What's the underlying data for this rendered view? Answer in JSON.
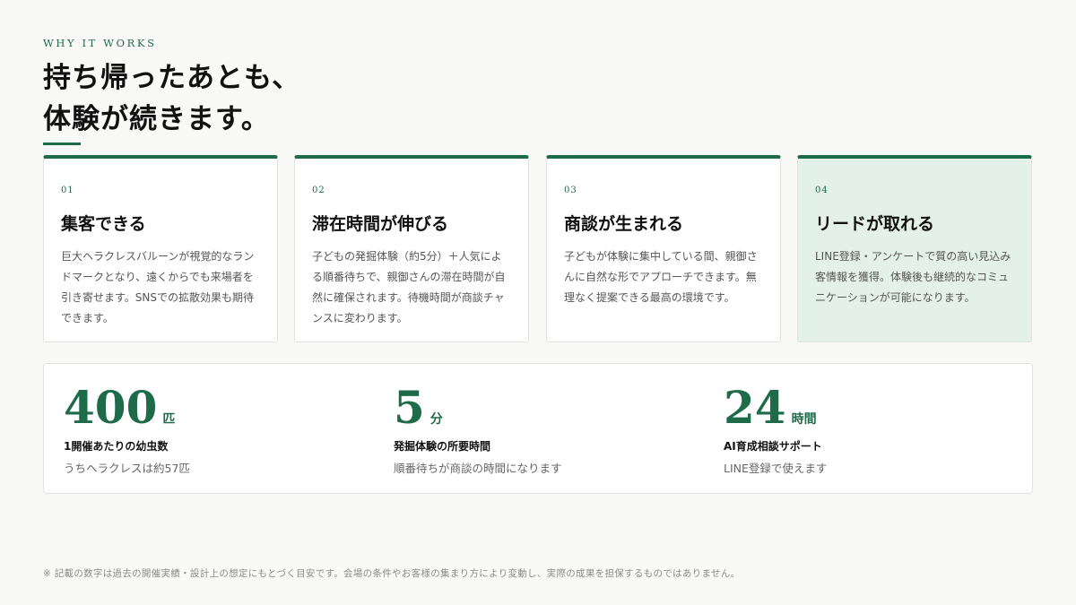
{
  "header": {
    "eyebrow": "WHY IT WORKS",
    "title_line1": "持ち帰ったあとも、",
    "title_line2": "体験が続きます。"
  },
  "cards": [
    {
      "num": "01",
      "title": "集客できる",
      "desc": "巨大ヘラクレスバルーンが視覚的なランドマークとなり、遠くからでも来場者を引き寄せます。SNSでの拡散効果も期待できます。"
    },
    {
      "num": "02",
      "title": "滞在時間が伸びる",
      "desc": "子どもの発掘体験（約5分）＋人気による順番待ちで、親御さんの滞在時間が自然に確保されます。待機時間が商談チャンスに変わります。"
    },
    {
      "num": "03",
      "title": "商談が生まれる",
      "desc": "子どもが体験に集中している間、親御さんに自然な形でアプローチできます。無理なく提案できる最高の環境です。"
    },
    {
      "num": "04",
      "title": "リードが取れる",
      "desc": "LINE登録・アンケートで質の高い見込み客情報を獲得。体験後も継続的なコミュニケーションが可能になります。"
    }
  ],
  "stats": [
    {
      "value": "400",
      "unit": "匹",
      "label": "1開催あたりの幼虫数",
      "sub": "うちヘラクレスは約57匹"
    },
    {
      "value": "5",
      "unit": "分",
      "label": "発掘体験の所要時間",
      "sub": "順番待ちが商談の時間になります"
    },
    {
      "value": "24",
      "unit": "時間",
      "label": "AI育成相談サポート",
      "sub": "LINE登録で使えます"
    }
  ],
  "footnote": "※ 記載の数字は過去の開催実績・設計上の想定にもとづく目安です。会場の条件やお客様の集まり方により変動し、実際の成果を担保するものではありません。",
  "colors": {
    "accent": "#1e6b4a",
    "highlight_bg": "#e4f0ea"
  }
}
